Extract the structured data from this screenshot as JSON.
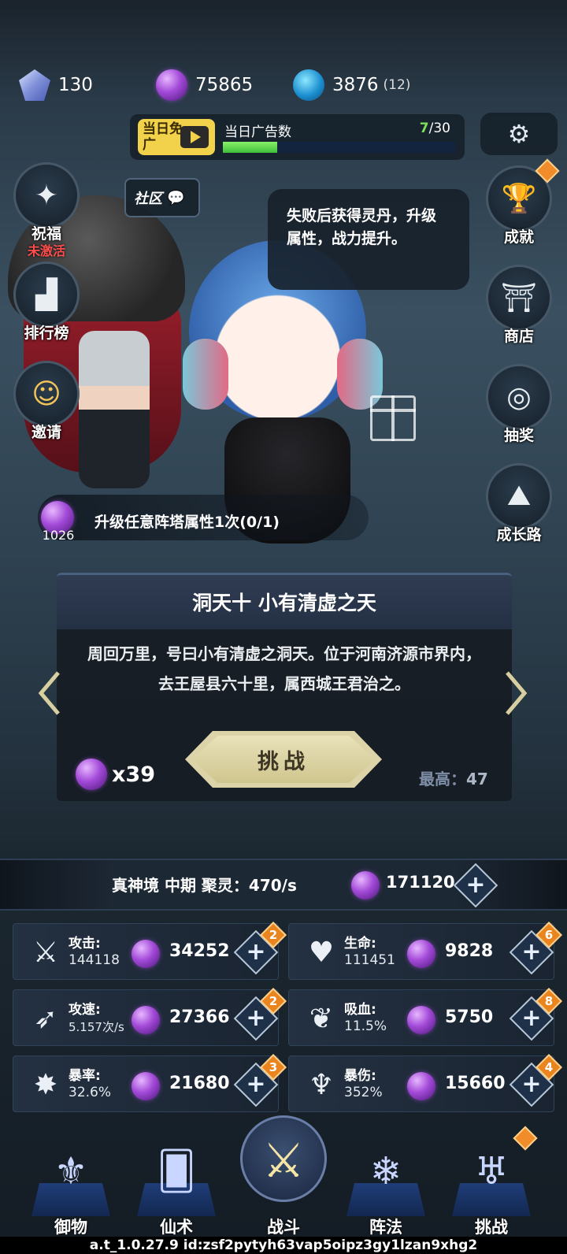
{
  "currencies": {
    "crystal": {
      "icon": "crystal-icon",
      "value": "130"
    },
    "spirit_orb": {
      "icon": "spirit-orb-icon",
      "value": "75865"
    },
    "energy": {
      "icon": "lightning-orb-icon",
      "value": "3876",
      "extra": "(12)"
    }
  },
  "ad": {
    "badge": "当日免广",
    "label": "当日广告数",
    "current": "7",
    "total": "/30",
    "progress": 0.233
  },
  "community_label": "社区",
  "left_buttons": [
    {
      "label": "祝福",
      "sub": "未激活",
      "icon": "blessing-icon"
    },
    {
      "label": "排行榜",
      "icon": "podium-icon"
    },
    {
      "label": "邀请",
      "icon": "invite-user-icon"
    }
  ],
  "right_buttons": [
    {
      "label": "成就",
      "icon": "trophy-icon"
    },
    {
      "label": "商店",
      "icon": "shop-icon"
    },
    {
      "label": "抽奖",
      "icon": "lottery-icon"
    },
    {
      "label": "成长路",
      "icon": "mountain-icon"
    }
  ],
  "speech": "失败后获得灵丹，升级属性，战力提升。",
  "task": {
    "orb_value": "1026",
    "text": "升级任意阵塔属性1次(0/1)"
  },
  "stage": {
    "title": "洞天十 小有清虚之天",
    "description": "周回万里，号曰小有清虚之洞天。位于河南济源市界内，去王屋县六十里，属西城王君治之。",
    "challenge_label": "挑战",
    "cost": "x39",
    "best_label": "最高：",
    "best_value": "47"
  },
  "realm": {
    "text": "真神境 中期 聚灵：470/s",
    "orbs": "171120"
  },
  "stats": [
    {
      "name": "攻击:",
      "value": "144118",
      "cost": "34252",
      "badge": "2",
      "icon": "sword-icon"
    },
    {
      "name": "生命:",
      "value": "111451",
      "cost": "9828",
      "badge": "6",
      "icon": "heart-icon"
    },
    {
      "name": "攻速:",
      "value": "5.157次/s",
      "cost": "27366",
      "badge": "2",
      "icon": "swift-sword-icon"
    },
    {
      "name": "吸血:",
      "value": "11.5%",
      "cost": "5750",
      "badge": "8",
      "icon": "lifesteal-icon"
    },
    {
      "name": "暴率:",
      "value": "32.6%",
      "cost": "21680",
      "badge": "3",
      "icon": "crit-icon"
    },
    {
      "name": "暴伤:",
      "value": "352%",
      "cost": "15660",
      "badge": "4",
      "icon": "crit-damage-icon"
    }
  ],
  "nav": [
    {
      "label": "御物",
      "icon": "weapon-icon"
    },
    {
      "label": "仙术",
      "icon": "spell-card-icon"
    },
    {
      "label": "战斗",
      "icon": "battle-icon"
    },
    {
      "label": "阵法",
      "icon": "formation-icon"
    },
    {
      "label": "挑战",
      "icon": "challenge-icon"
    }
  ],
  "version": "a.t_1.0.27.9 id:zsf2pytyh63vap5oipz3gy1lzan9xhg2"
}
